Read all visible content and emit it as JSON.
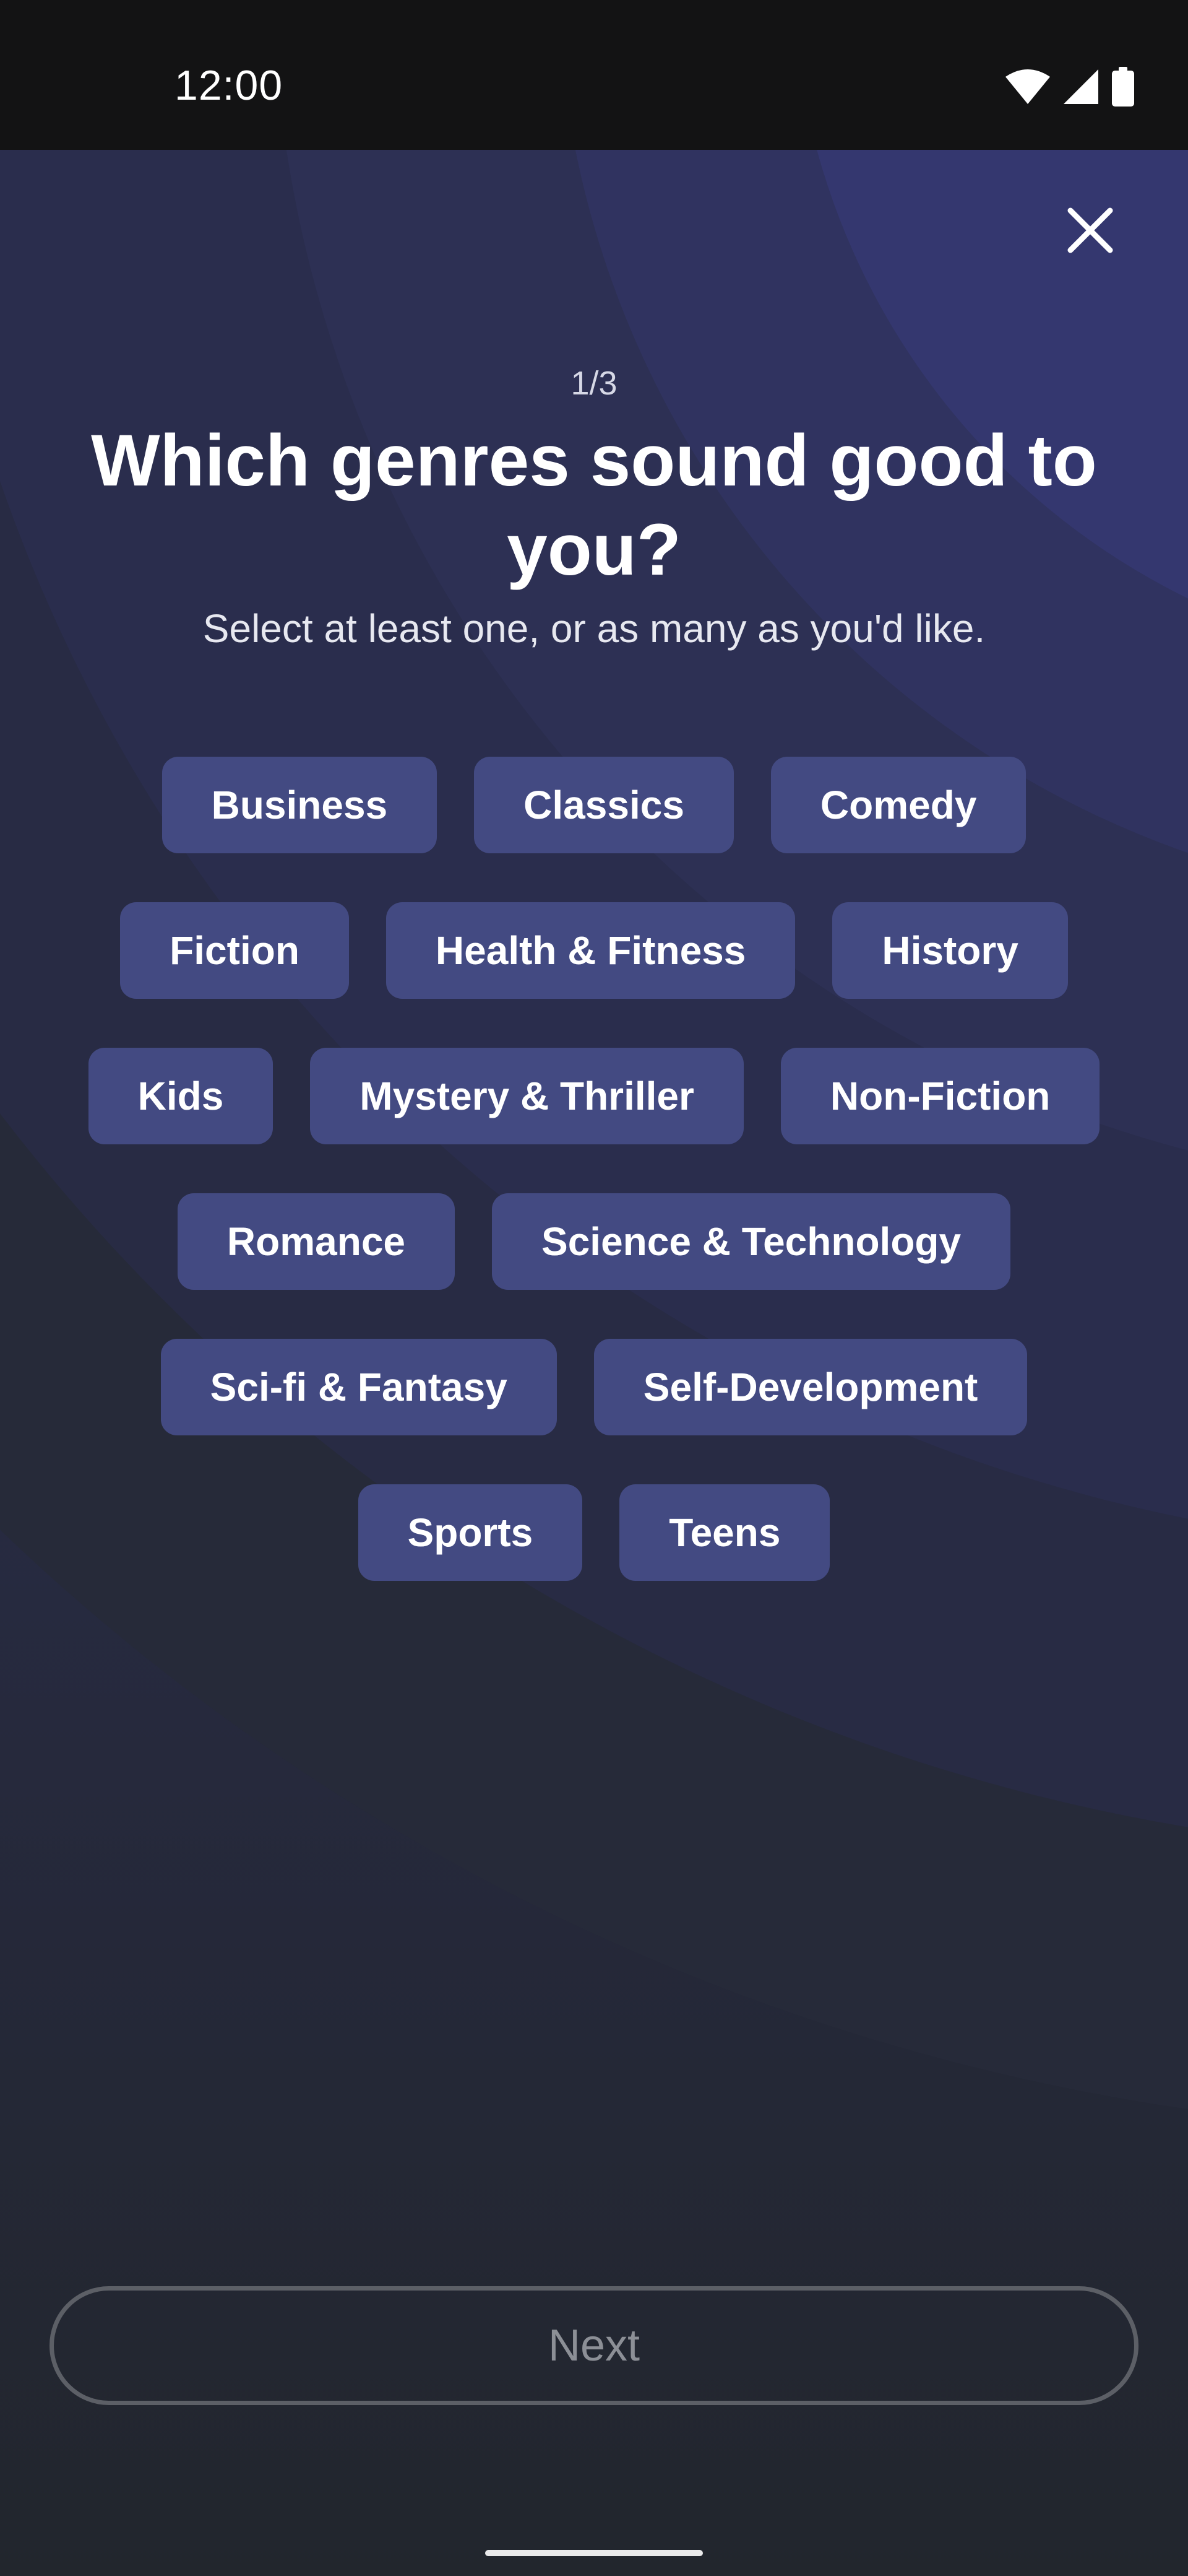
{
  "status_bar": {
    "time": "12:00",
    "icons": [
      "wifi-icon",
      "cellular-signal-icon",
      "battery-icon"
    ]
  },
  "header": {
    "close_icon": "close-icon"
  },
  "onboarding": {
    "step": "1/3",
    "title": "Which genres sound good to you?",
    "subtitle": "Select at least one, or as many as you'd like."
  },
  "genres": [
    [
      "Business",
      "Classics",
      "Comedy"
    ],
    [
      "Fiction",
      "Health & Fitness",
      "History"
    ],
    [
      "Kids",
      "Mystery & Thriller",
      "Non-Fiction"
    ],
    [
      "Romance",
      "Science & Technology"
    ],
    [
      "Sci-fi & Fantasy",
      "Self-Development"
    ],
    [
      "Sports",
      "Teens"
    ]
  ],
  "footer": {
    "next_label": "Next"
  },
  "colors": {
    "background_top": "#34376f",
    "background_bottom": "#22262d",
    "chip_background": "#434a82",
    "status_bar": "#131314"
  }
}
